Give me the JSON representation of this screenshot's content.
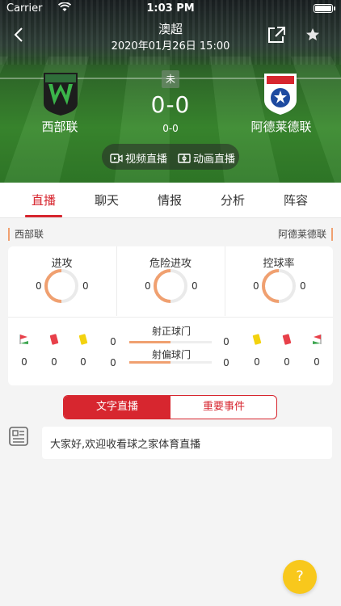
{
  "status_bar": {
    "carrier": "Carrier",
    "time": "1:03 PM"
  },
  "header": {
    "league": "澳超",
    "datetime": "2020年01月26日 15:00"
  },
  "match": {
    "home_team": "西部联",
    "away_team": "阿德莱德联",
    "home_logo_text": "WESTERN UNITED F.C.",
    "away_logo_text": "ADELAIDE UNITED F.C.",
    "status": "未",
    "score": "0-0",
    "half_score": "0-0",
    "video_live_label": "视频直播",
    "animation_live_label": "动画直播"
  },
  "tabs": [
    {
      "label": "直播",
      "active": true
    },
    {
      "label": "聊天",
      "active": false
    },
    {
      "label": "情报",
      "active": false
    },
    {
      "label": "分析",
      "active": false
    },
    {
      "label": "阵容",
      "active": false
    }
  ],
  "stats": {
    "home_label": "西部联",
    "away_label": "阿德莱德联",
    "rings": [
      {
        "label": "进攻",
        "home": "0",
        "away": "0"
      },
      {
        "label": "危险进攻",
        "home": "0",
        "away": "0"
      },
      {
        "label": "控球率",
        "home": "0",
        "away": "0"
      }
    ],
    "events_home": {
      "corners": "0",
      "red_cards": "0",
      "yellow_cards": "0"
    },
    "events_away": {
      "yellow_cards": "0",
      "red_cards": "0",
      "corners": "0"
    },
    "shots_on_target": {
      "label": "射正球门",
      "home": "0",
      "away": "0"
    },
    "shots_off_target": {
      "label": "射偏球门",
      "home": "0",
      "away": "0"
    },
    "ring_color": "#f0a070"
  },
  "segment": {
    "live_label": "文字直播",
    "events_label": "重要事件"
  },
  "commentary": {
    "message": "大家好,欢迎收看球之家体育直播"
  },
  "help_button": {
    "label": "?"
  },
  "colors": {
    "accent": "#d7262f",
    "help": "#f8c81c"
  }
}
